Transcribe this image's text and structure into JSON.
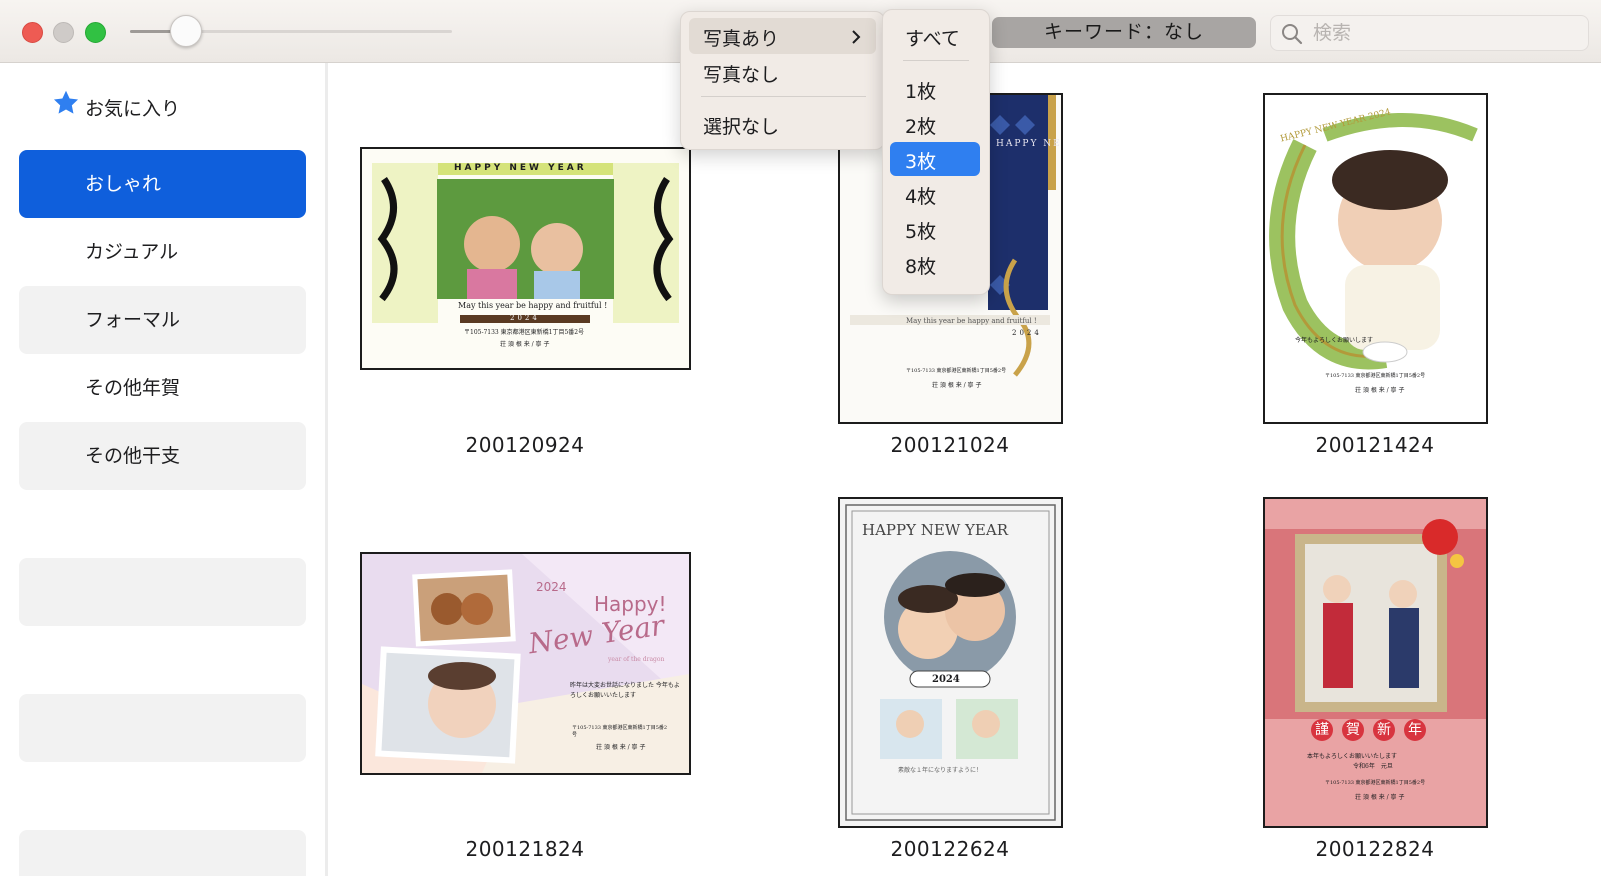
{
  "toolbar": {
    "zoom_slider_value": 0.17,
    "keyword_button": "キーワード：なし",
    "search_placeholder": "検索"
  },
  "sidebar": {
    "favorites_label": "お気に入り",
    "items": [
      {
        "label": "おしゃれ",
        "selected": true
      },
      {
        "label": "カジュアル"
      },
      {
        "label": "フォーマル"
      },
      {
        "label": "その他年賀"
      },
      {
        "label": "その他干支"
      },
      {
        "label": ""
      },
      {
        "label": ""
      },
      {
        "label": ""
      }
    ]
  },
  "menu": {
    "items": [
      {
        "label": "写真あり",
        "highlighted": true,
        "has_submenu": true
      },
      {
        "label": "写真なし"
      },
      {
        "label": "選択なし"
      }
    ],
    "submenu": [
      {
        "label": "すべて"
      },
      {
        "label": "1枚"
      },
      {
        "label": "2枚"
      },
      {
        "label": "3枚",
        "selected": true
      },
      {
        "label": "4枚"
      },
      {
        "label": "5枚"
      },
      {
        "label": "8枚"
      }
    ]
  },
  "cards": [
    {
      "id": "200120924",
      "header": "HAPPY NEW YEAR",
      "message": "May this year be happy and fruitful !",
      "year": "2024",
      "address": "〒105-7133 東京都港区東新橋1丁目5番2号",
      "names": "荘 須 根 来 / 寧 子"
    },
    {
      "id": "200121024",
      "header": "HAPPY NEW YEAR",
      "message": "May this year be happy and fruitful !",
      "year": "2024",
      "address": "〒105-7133 東京都港区東新橋1丁目5番2号",
      "names": "荘 須 根 来 / 寧 子"
    },
    {
      "id": "200121424",
      "header": "HAPPY NEW YEAR 2024",
      "message": "今年もよろしくお願いします",
      "address": "〒105-7133 東京都港区東新橋1丁目5番2号",
      "names": "荘 須 根 来 / 寧 子"
    },
    {
      "id": "200121824",
      "year": "2024",
      "header": "Happy!",
      "script": "New Year",
      "sub": "year of the dragon",
      "message": "昨年は大変お世話になりました 今年もよろしくお願いいたします",
      "address": "〒105-7133 東京都港区東新橋1丁目5番2号",
      "names": "荘 須 根 来 / 寧 子"
    },
    {
      "id": "200122624",
      "header": "HAPPY NEW YEAR",
      "year": "2024",
      "message": "素敵な１年になりますように！"
    },
    {
      "id": "200122824",
      "kanji": [
        "謹",
        "賀",
        "新",
        "年"
      ],
      "message": "本年もよろしくお願いいたします",
      "date": "令和6年　元旦",
      "address": "〒105-7133 東京都港区東新橋1丁目5番2号",
      "names": "荘 須 根 来 / 寧 子"
    }
  ],
  "colors": {
    "selection_blue": "#0f5fdc",
    "sidebar_gray": "#f2f2f2",
    "menu_bg": "#f1ebe6"
  }
}
